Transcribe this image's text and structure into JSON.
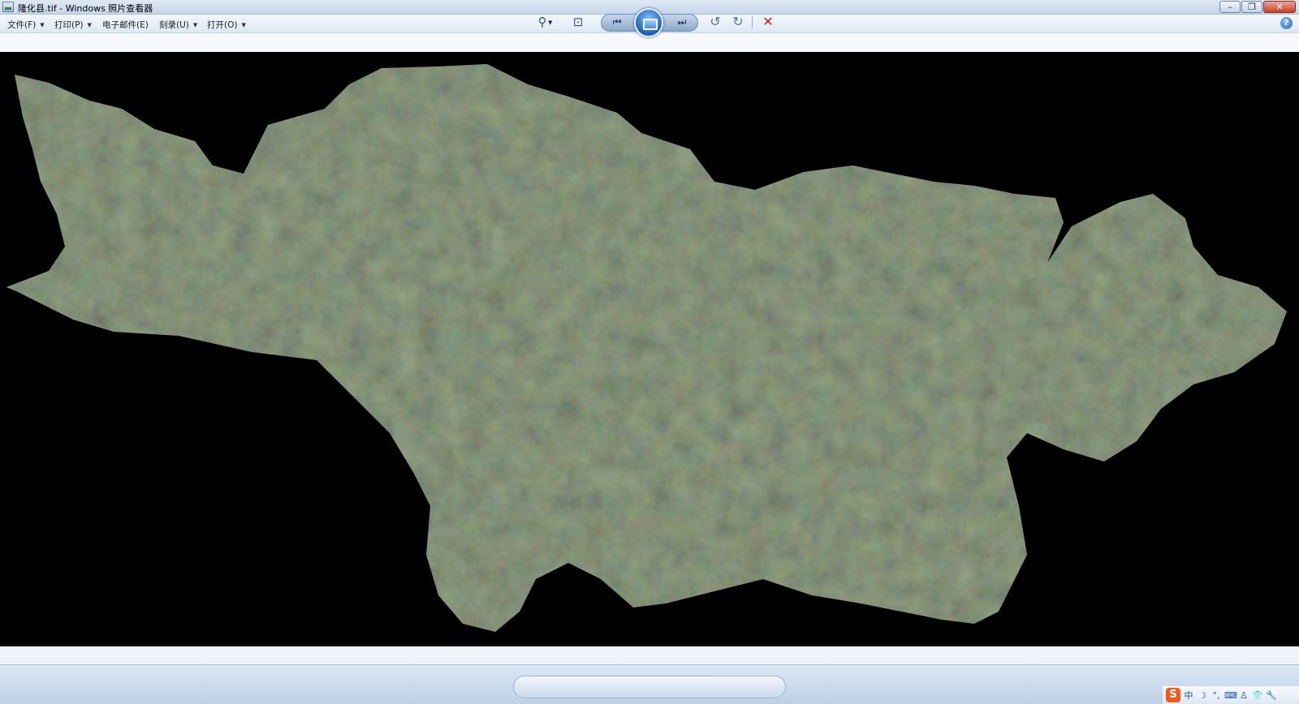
{
  "window": {
    "title": "隆化县.tif - Windows 照片查看器",
    "minimize_glyph": "–",
    "restore_glyph": "❐",
    "close_glyph": "✕"
  },
  "menu": {
    "items": [
      {
        "label": "文件(F)",
        "has_dropdown": true
      },
      {
        "label": "打印(P)",
        "has_dropdown": true
      },
      {
        "label": "电子邮件(E)",
        "has_dropdown": false
      },
      {
        "label": "刻录(U)",
        "has_dropdown": true
      },
      {
        "label": "打开(O)",
        "has_dropdown": true
      }
    ],
    "dropdown_glyph": "▼",
    "help_glyph": "?"
  },
  "toolbar": {
    "zoom_glyph": "⚲",
    "dropdown_glyph": "▼",
    "fit_glyph": "⊡",
    "prev_glyph": "⏮",
    "next_glyph": "⏭",
    "rotate_left_glyph": "↺",
    "rotate_right_glyph": "↻",
    "delete_glyph": "✕"
  },
  "ime": {
    "logo": "S",
    "items": [
      "中",
      "☽",
      "°,",
      "⌨",
      "♙",
      "👕",
      "🔧"
    ]
  },
  "colors": {
    "background_image_area": "#000000",
    "terrain_dark": "#2f3d2b",
    "terrain_light": "#6e7258",
    "accent_blue": "#1f5fb8",
    "delete_red": "#d01818"
  }
}
